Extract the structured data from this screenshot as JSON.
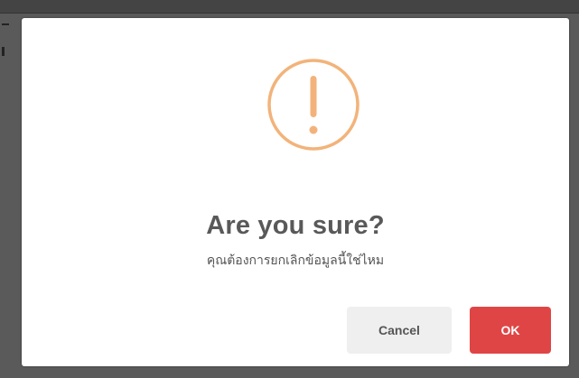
{
  "dialog": {
    "title": "Are you sure?",
    "message": "คุณต้องการยกเลิกข้อมูลนี้ใช่ไหม",
    "icon": "warning-icon",
    "cancel_label": "Cancel",
    "ok_label": "OK"
  },
  "colors": {
    "icon_ring": "#f2b37a",
    "ok_button": "#e04545",
    "cancel_button": "#efefef",
    "title_text": "#595959",
    "backdrop": "#5a5a5a"
  }
}
